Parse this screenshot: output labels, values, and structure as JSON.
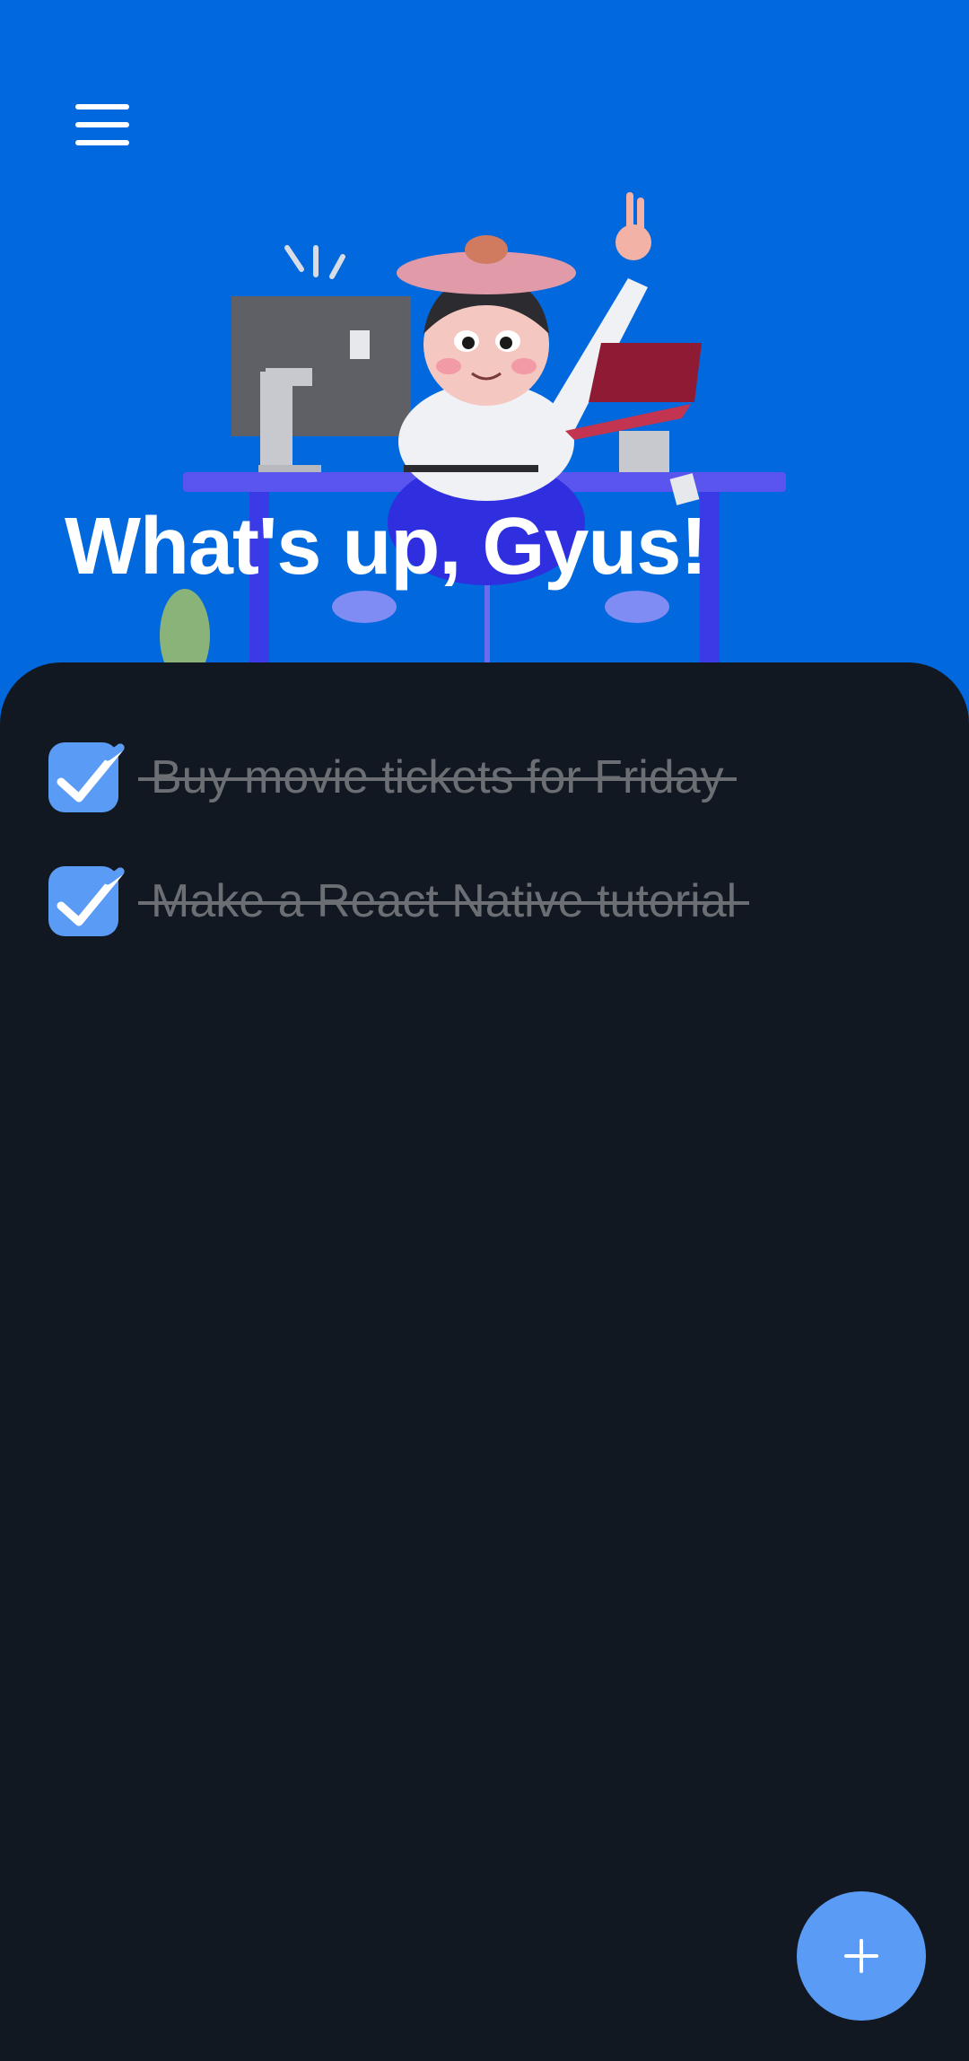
{
  "header": {
    "greeting": "What's up, Gyus!",
    "menu_icon": "hamburger-menu-icon",
    "illustration": "person-at-desk-illustration"
  },
  "tasks": [
    {
      "label": "Buy movie tickets for Friday",
      "done": true
    },
    {
      "label": "Make a React Native tutorial",
      "done": true
    }
  ],
  "fab": {
    "icon": "plus-icon"
  },
  "colors": {
    "header_bg": "#0168dd",
    "sheet_bg": "#121821",
    "accent": "#5a9cf5",
    "done_text": "#6b6e73"
  }
}
